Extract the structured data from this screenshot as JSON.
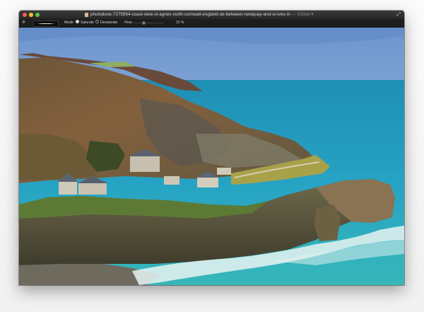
{
  "window": {
    "title": "photodune-7375994-coast-view-st-agnes-north-cornwall-england-uk-between-newquay-and-st-ives-m",
    "separator": "—",
    "status": "Edited ▾"
  },
  "toolbar": {
    "mode_label": "Mode:",
    "options": [
      "Saturate",
      "Desaturate"
    ],
    "selected_option": "Saturate",
    "flow_label": "Flow",
    "flow_value": 0.35,
    "zoom_label": "31 %"
  },
  "icons": {
    "close": "close-button",
    "minimize": "minimize-button",
    "maximize": "maximize-button",
    "document": "document-icon",
    "fullscreen": "fullscreen-icon",
    "brush": "brush-settings-icon"
  },
  "colors": {
    "window_chrome": "#2b2b2b",
    "toolbar": "#1d1d1d",
    "traffic_close": "#ee5d55",
    "traffic_min": "#f5bd33",
    "traffic_max": "#5ac93f"
  }
}
